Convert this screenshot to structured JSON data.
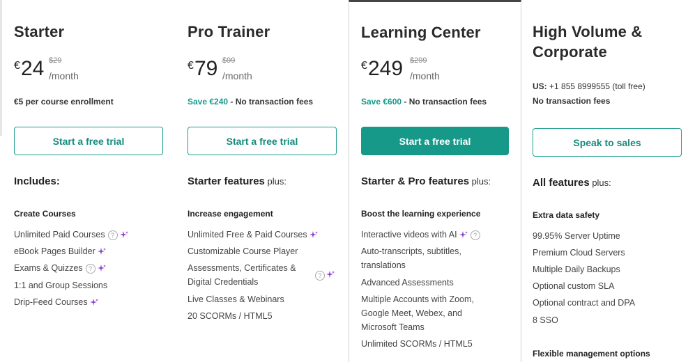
{
  "plans": [
    {
      "title": "Starter",
      "currency": "€",
      "price": "24",
      "old_price": "$29",
      "per": "/month",
      "note_strong": "€5 per course enrollment",
      "cta": "Start a free trial",
      "includes": "Includes:",
      "group": "Create Courses",
      "features": [
        "Unlimited Paid Courses",
        "eBook Pages Builder",
        "Exams & Quizzes",
        "1:1 and Group Sessions",
        "Drip-Feed Courses"
      ]
    },
    {
      "title": "Pro Trainer",
      "currency": "€",
      "price": "79",
      "old_price": "$99",
      "per": "/month",
      "save": "Save €240",
      "note_rest": " - No transaction fees",
      "cta": "Start a free trial",
      "includes": "Starter features",
      "includes_suffix": " plus:",
      "group": "Increase engagement",
      "features": [
        "Unlimited Free & Paid Courses",
        "Customizable Course Player",
        "Assessments, Certificates & Digital Credentials",
        "Live Classes & Webinars",
        "20 SCORMs / HTML5"
      ]
    },
    {
      "title": "Learning Center",
      "currency": "€",
      "price": "249",
      "old_price": "$299",
      "per": "/month",
      "save": "Save €600",
      "note_rest": " - No transaction fees",
      "cta": "Start a free trial",
      "includes": "Starter & Pro features",
      "includes_suffix": " plus:",
      "group": "Boost the learning experience",
      "features": [
        "Interactive videos with AI",
        "Auto-transcripts, subtitles, translations",
        "Advanced Assessments",
        "Multiple Accounts with Zoom, Google Meet, Webex, and Microsoft Teams",
        "Unlimited SCORMs / HTML5"
      ]
    },
    {
      "title": "High Volume & Corporate",
      "phone_label": "US:",
      "phone": " +1 855 8999555 (toll free)",
      "note_strong": "No transaction fees",
      "cta": "Speak to sales",
      "includes": "All features",
      "includes_suffix": " plus:",
      "group": "Extra data safety",
      "features": [
        "99.95% Server Uptime",
        "Premium Cloud Servers",
        "Multiple Daily Backups",
        "Optional custom SLA",
        "Optional contract and DPA",
        "8 SSO"
      ],
      "group2": "Flexible management options"
    }
  ],
  "colors": {
    "accent": "#17998a",
    "sparkle": "#8b3fd1"
  },
  "icons": {
    "help": "question-circle-icon",
    "ai": "sparkle-icon"
  }
}
